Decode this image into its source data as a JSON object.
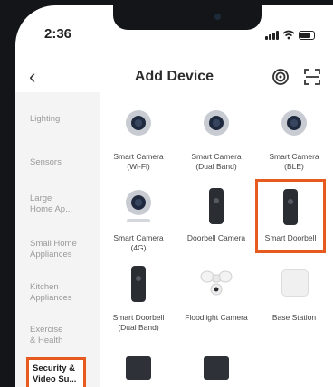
{
  "status_bar": {
    "time": "2:36"
  },
  "nav": {
    "title": "Add Device"
  },
  "sidebar": {
    "items": [
      {
        "label": "Lighting"
      },
      {
        "label": "Sensors"
      },
      {
        "label": "Large\nHome Ap..."
      },
      {
        "label": "Small Home\nAppliances"
      },
      {
        "label": "Kitchen\nAppliances"
      },
      {
        "label": "Exercise\n& Health"
      },
      {
        "label": "Security &\nVideo Su...",
        "selected": true
      }
    ]
  },
  "devices": [
    {
      "label": "Smart Camera\n(Wi-Fi)",
      "icon": "camera-icon"
    },
    {
      "label": "Smart Camera\n(Dual Band)",
      "icon": "camera-icon"
    },
    {
      "label": "Smart Camera\n(BLE)",
      "icon": "camera-icon"
    },
    {
      "label": "Smart Camera\n(4G)",
      "icon": "camera-icon"
    },
    {
      "label": "Doorbell Camera",
      "icon": "doorbell-icon"
    },
    {
      "label": "Smart Doorbell",
      "icon": "doorbell-icon",
      "highlighted": true
    },
    {
      "label": "Smart Doorbell\n(Dual Band)",
      "icon": "doorbell-icon"
    },
    {
      "label": "Floodlight Camera",
      "icon": "floodlight-icon"
    },
    {
      "label": "Base Station",
      "icon": "base-station-icon"
    },
    {
      "label": "",
      "icon": "hub-icon"
    },
    {
      "label": "",
      "icon": "hub-icon"
    }
  ],
  "colors": {
    "highlight": "#e65a1f",
    "sidebar_bg": "#f4f4f4"
  }
}
